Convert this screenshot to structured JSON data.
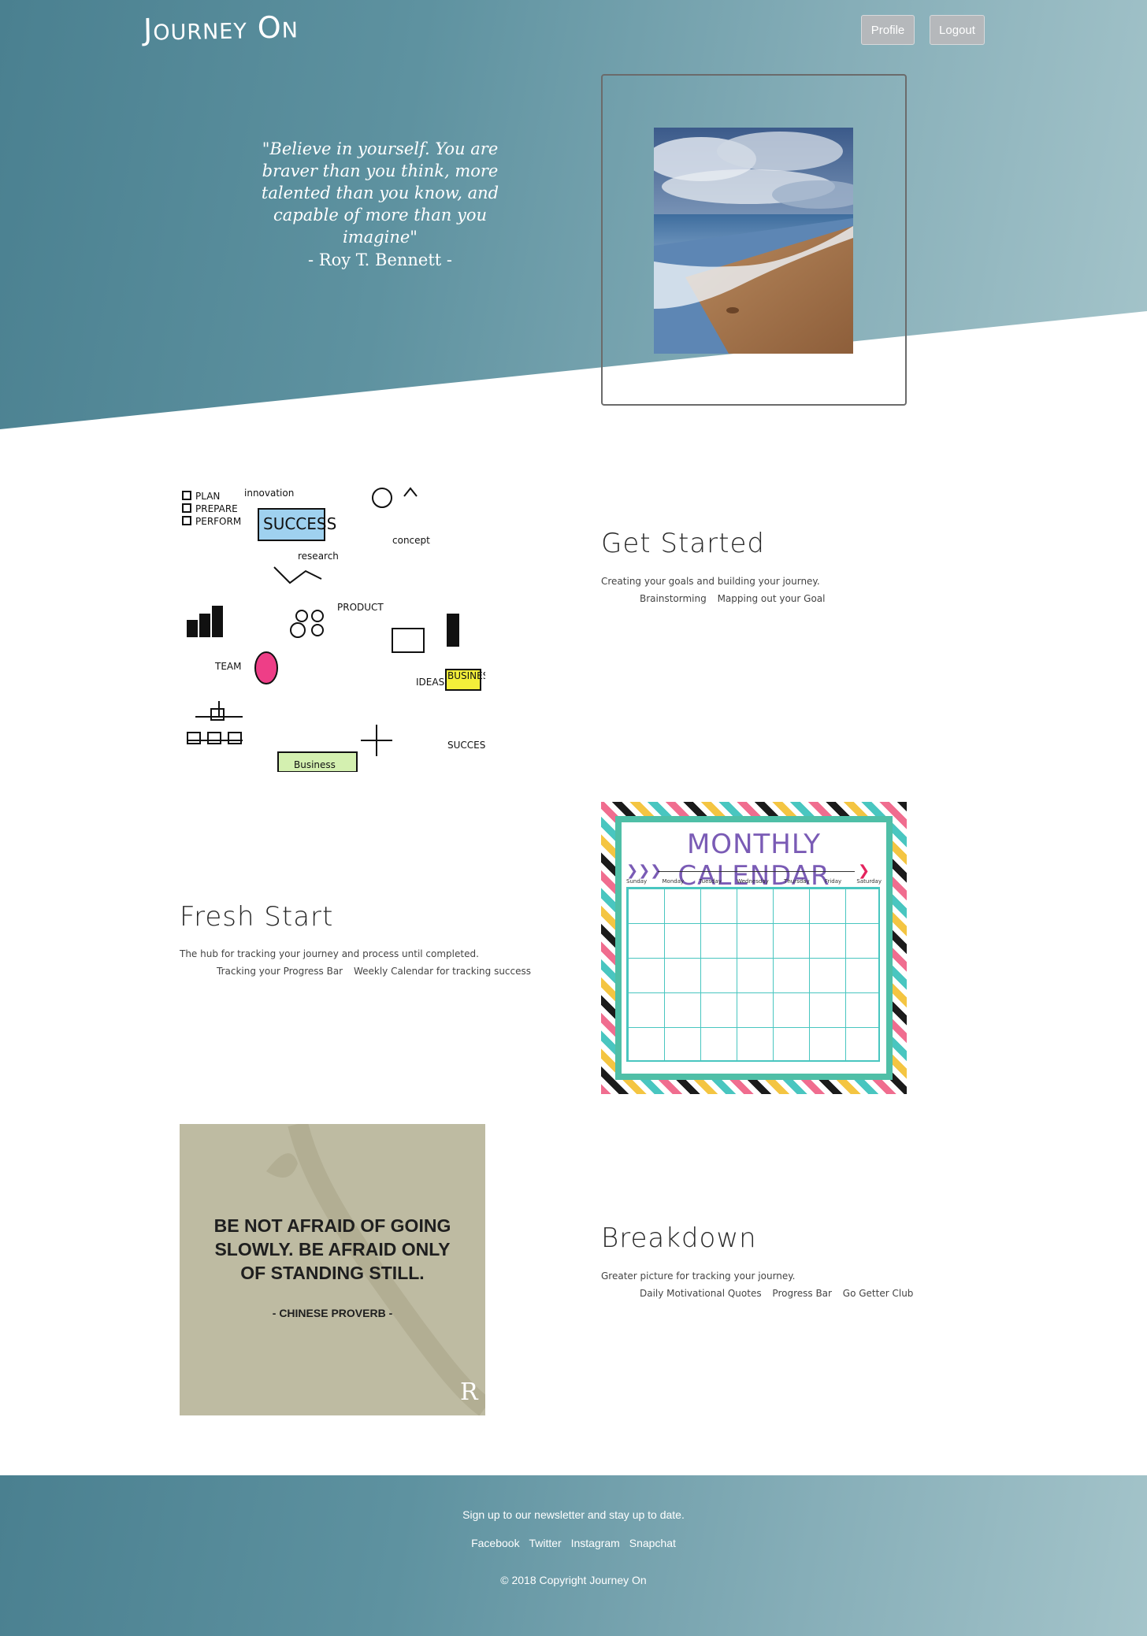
{
  "header": {
    "brand": "Journey On",
    "profile_label": "Profile",
    "logout_label": "Logout"
  },
  "hero": {
    "quote": "\"Believe in yourself. You are braver than you think, more talented than you know, and capable of more than you imagine\"",
    "author": "- Roy T. Bennett -"
  },
  "sections": [
    {
      "title": "Get Started",
      "description": "Creating your goals and building your journey.",
      "links": [
        "Brainstorming",
        "Mapping out your Goal"
      ]
    },
    {
      "title": "Fresh Start",
      "description": "The hub for tracking your journey and process until completed.",
      "links": [
        "Tracking your Progress Bar",
        "Weekly Calendar for tracking success"
      ]
    },
    {
      "title": "Breakdown",
      "description": "Greater picture for tracking your journey.",
      "links": [
        "Daily Motivational Quotes",
        "Progress Bar",
        "Go Getter Club"
      ]
    }
  ],
  "calendar": {
    "title": "MONTHLY CALENDAR",
    "days": [
      "Sunday",
      "Monday",
      "Tuesday",
      "Wednesday",
      "Thursday",
      "Friday",
      "Saturday"
    ]
  },
  "proverb": {
    "text": "BE NOT AFRAID OF GOING SLOWLY. BE AFRAID ONLY OF STANDING STILL.",
    "source": "- CHINESE PROVERB -"
  },
  "footer": {
    "newsletter": "Sign up to our newsletter and stay up to date.",
    "social": [
      "Facebook",
      "Twitter",
      "Instagram",
      "Snapchat"
    ],
    "copyright": "© 2018 Copyright Journey On"
  },
  "colors": {
    "hero_start": "#4a8090",
    "hero_end": "#a4c4ca",
    "button_bg": "#b5b8bb"
  }
}
